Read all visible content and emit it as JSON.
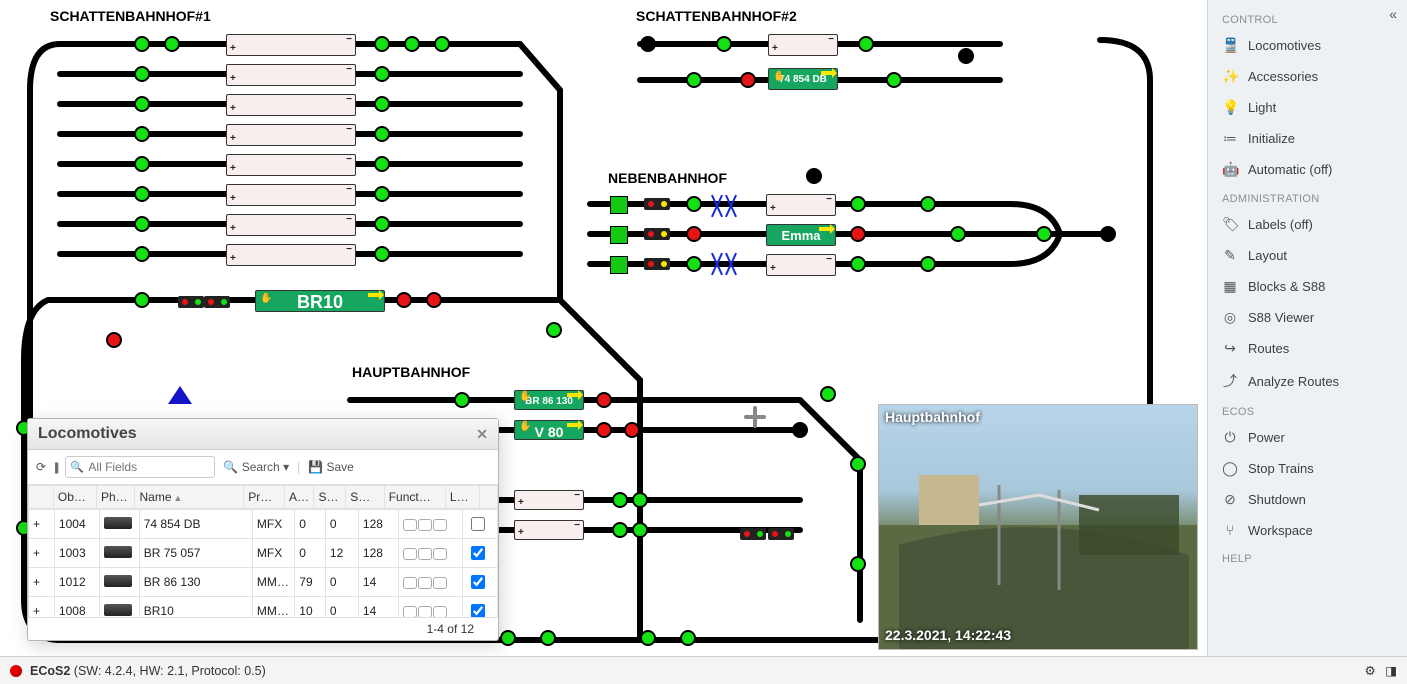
{
  "sidebar": {
    "collapse_glyph": "«",
    "groups": [
      {
        "title": "CONTROL",
        "items": [
          {
            "icon": "🚆",
            "label": "Locomotives",
            "name": "sidebar-item-locomotives"
          },
          {
            "icon": "✨",
            "label": "Accessories",
            "name": "sidebar-item-accessories"
          },
          {
            "icon": "💡",
            "label": "Light",
            "name": "sidebar-item-light"
          },
          {
            "icon": "≔",
            "label": "Initialize",
            "name": "sidebar-item-initialize"
          },
          {
            "icon": "🤖",
            "label": "Automatic (off)",
            "name": "sidebar-item-automatic"
          }
        ]
      },
      {
        "title": "ADMINISTRATION",
        "items": [
          {
            "icon": "🏷",
            "label": "Labels (off)",
            "name": "sidebar-item-labels"
          },
          {
            "icon": "✎",
            "label": "Layout",
            "name": "sidebar-item-layout"
          },
          {
            "icon": "▦",
            "label": "Blocks & S88",
            "name": "sidebar-item-blocks"
          },
          {
            "icon": "◎",
            "label": "S88 Viewer",
            "name": "sidebar-item-s88viewer"
          },
          {
            "icon": "↪",
            "label": "Routes",
            "name": "sidebar-item-routes"
          },
          {
            "icon": "⤴",
            "label": "Analyze Routes",
            "name": "sidebar-item-analyze"
          }
        ]
      },
      {
        "title": "ECOS",
        "items": [
          {
            "icon": "⏻",
            "label": "Power",
            "name": "sidebar-item-power"
          },
          {
            "icon": "◯",
            "label": "Stop Trains",
            "name": "sidebar-item-stoptrains"
          },
          {
            "icon": "⊘",
            "label": "Shutdown",
            "name": "sidebar-item-shutdown"
          },
          {
            "icon": "⑂",
            "label": "Workspace",
            "name": "sidebar-item-workspace"
          }
        ]
      },
      {
        "title": "HELP",
        "items": []
      }
    ]
  },
  "status": {
    "name": "ECoS2",
    "details": "(SW: 4.2.4, HW: 2.1, Protocol: 0.5)"
  },
  "sections": {
    "s1": "SCHATTENBAHNHOF#1",
    "s2": "SCHATTENBAHNHOF#2",
    "neben": "NEBENBAHNHOF",
    "haupt": "HAUPTBAHNHOF"
  },
  "blocks": {
    "br10": "BR10",
    "emma": "Emma",
    "db74": "74 854 DB",
    "br86": "BR 86 130",
    "v80": "V 80"
  },
  "camera": {
    "title": "Hauptbahnhof",
    "timestamp": "22.3.2021, 14:22:43"
  },
  "locowin": {
    "title": "Locomotives",
    "toolbar": {
      "search_placeholder": "All Fields",
      "search_label": "Search",
      "save_label": "Save"
    },
    "columns": [
      "",
      "Ob…",
      "Ph…",
      "Name",
      "Pr…",
      "A…",
      "S…",
      "S…",
      "Funct…",
      "Lo…"
    ],
    "rows": [
      {
        "exp": "+",
        "obj": "1004",
        "name": "74 854 DB",
        "proto": "MFX",
        "a": "0",
        "s1": "0",
        "s2": "128",
        "locked": false
      },
      {
        "exp": "+",
        "obj": "1003",
        "name": "BR 75 057",
        "proto": "MFX",
        "a": "0",
        "s1": "12",
        "s2": "128",
        "locked": true
      },
      {
        "exp": "+",
        "obj": "1012",
        "name": "BR 86 130",
        "proto": "MM…",
        "a": "79",
        "s1": "0",
        "s2": "14",
        "locked": true
      },
      {
        "exp": "+",
        "obj": "1008",
        "name": "BR10",
        "proto": "MM…",
        "a": "10",
        "s1": "0",
        "s2": "14",
        "locked": true
      }
    ],
    "footer": "1-4 of 12"
  }
}
